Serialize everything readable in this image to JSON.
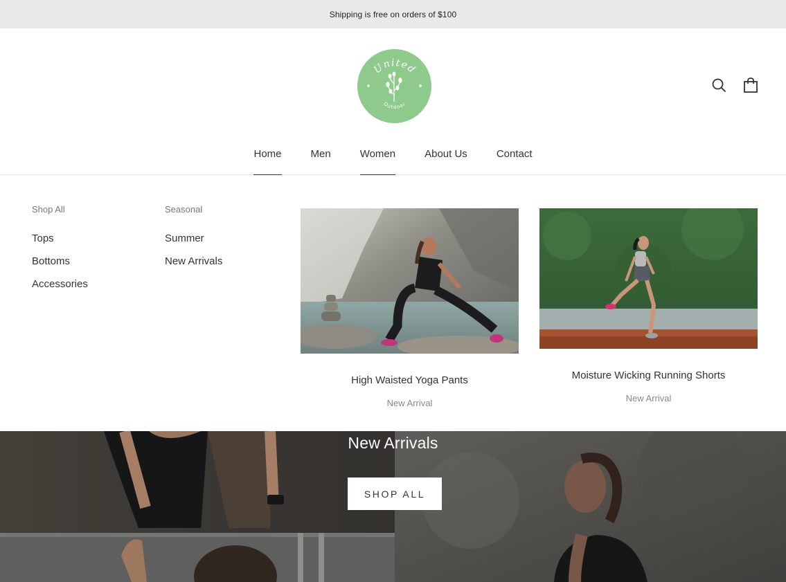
{
  "announcement": {
    "text": "Shipping is free on orders of $100"
  },
  "logo": {
    "line1": "United",
    "line2": "Outdoor",
    "color": "#8fca8d",
    "icon": "branch-icon"
  },
  "header": {
    "search_icon": "search-icon",
    "cart_icon": "shopping-bag-icon"
  },
  "nav": {
    "items": [
      {
        "label": "Home"
      },
      {
        "label": "Men"
      },
      {
        "label": "Women"
      },
      {
        "label": "About Us"
      },
      {
        "label": "Contact"
      }
    ]
  },
  "mega_menu": {
    "columns": [
      {
        "title": "Shop All",
        "links": [
          "Tops",
          "Bottoms",
          "Accessories"
        ]
      },
      {
        "title": "Seasonal",
        "links": [
          "Summer",
          "New Arrivals"
        ]
      }
    ],
    "promos": [
      {
        "title": "High Waisted Yoga Pants",
        "subtitle": "New Arrival"
      },
      {
        "title": "Moisture Wicking Running Shorts",
        "subtitle": "New Arrival"
      }
    ]
  },
  "hero": {
    "title": "New Arrivals",
    "button_label": "SHOP ALL"
  }
}
